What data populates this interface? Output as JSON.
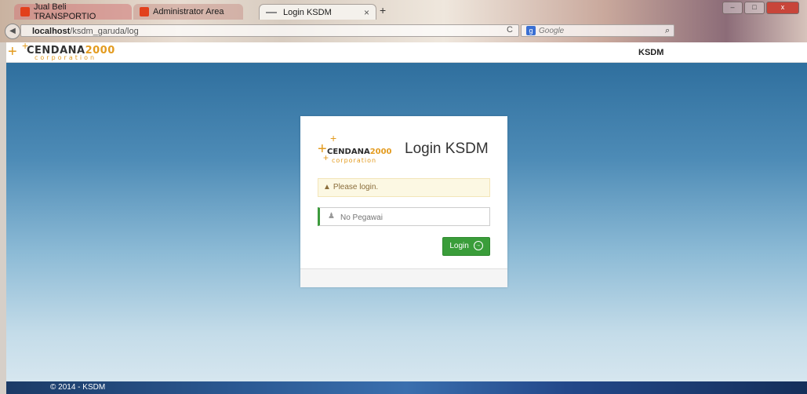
{
  "browser": {
    "tabs": [
      {
        "label": "Jual Beli TRANSPORTIO"
      },
      {
        "label": "Administrator Area"
      },
      {
        "label": "Login KSDM"
      }
    ],
    "new_tab": "+",
    "url_host": "localhost",
    "url_path": "/ksdm_garuda/log",
    "search_placeholder": "Google",
    "search_engine": "g",
    "window_buttons": {
      "minimize": "–",
      "maximize": "□",
      "close": "x"
    }
  },
  "navbar": {
    "brand_name_a": "CENDANA",
    "brand_name_b": "2000",
    "brand_sub": "corporation",
    "right_label": "KSDM"
  },
  "login": {
    "logo_name_a": "CENDANA",
    "logo_name_b": "2000",
    "logo_sub": "corporation",
    "title": "Login KSDM",
    "alert_text": "Please login.",
    "input_placeholder": "No Pegawai",
    "input_value": "",
    "button_label": "Login"
  },
  "footer": {
    "text": "© 2014 - KSDM"
  },
  "colors": {
    "accent": "#e39b1f",
    "button": "#3a9d3a",
    "alert_bg": "#fcf8e3"
  }
}
